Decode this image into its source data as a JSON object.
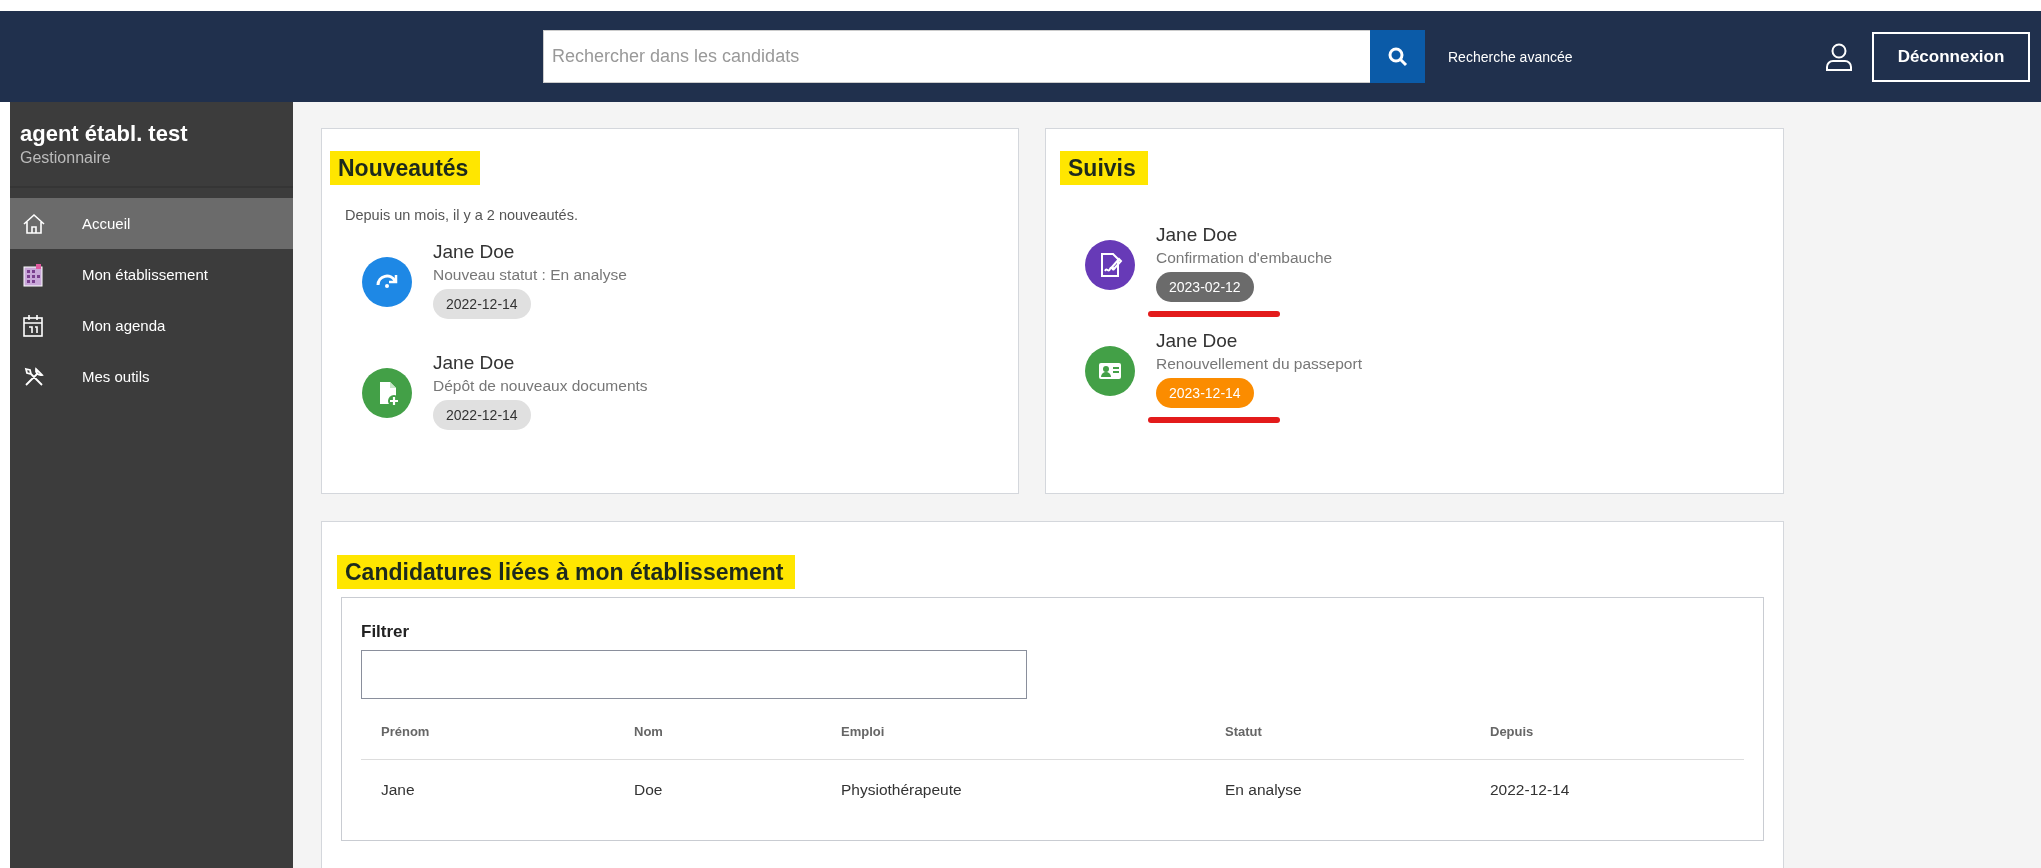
{
  "header": {
    "search": {
      "placeholder": "Rechercher dans les candidats"
    },
    "advanced_search": "Recherche avancée",
    "logout": "Déconnexion"
  },
  "sidebar": {
    "user_name": "agent établ. test",
    "role": "Gestionnaire",
    "items": [
      {
        "label": "Accueil",
        "selected": true
      },
      {
        "label": "Mon établissement",
        "selected": false
      },
      {
        "label": "Mon agenda",
        "selected": false
      },
      {
        "label": "Mes outils",
        "selected": false
      }
    ]
  },
  "news": {
    "title": "Nouveautés",
    "highlighted": true,
    "summary": "Depuis un mois, il y a 2 nouveautés.",
    "items": [
      {
        "kind": "status",
        "name": "Jane Doe",
        "description": "Nouveau statut : En analyse",
        "color": "#1e88e5",
        "date": {
          "text": "2022-12-14",
          "color": "#e0e0e0"
        }
      },
      {
        "kind": "upload",
        "name": "Jane Doe",
        "description": "Dépôt de nouveaux documents",
        "color": "#43a047",
        "date": {
          "text": "2022-12-14",
          "color": "#e0e0e0"
        }
      }
    ]
  },
  "follow_ups": {
    "title": "Suivis",
    "highlighted": true,
    "items": [
      {
        "kind": "signature",
        "name": "Jane Doe",
        "description": "Confirmation d'embauche",
        "color": "#673ab7",
        "date": {
          "text": "2023-02-12",
          "color": "#6b6b6b"
        },
        "underlined": true
      },
      {
        "kind": "passport",
        "name": "Jane Doe",
        "description": "Renouvellement du passeport",
        "color": "#43a047",
        "date": {
          "text": "2023-12-14",
          "color": "#fb8c00"
        },
        "underlined": true
      }
    ]
  },
  "applications": {
    "title": "Candidatures liées à mon établissement",
    "highlighted": true,
    "filter": {
      "label": "Filtrer"
    },
    "table": {
      "columns": [
        "Prénom",
        "Nom",
        "Emploi",
        "Statut",
        "Depuis"
      ],
      "rows": [
        [
          "Jane",
          "Doe",
          "Physiothérapeute",
          "En analyse",
          "2022-12-14"
        ]
      ]
    }
  }
}
